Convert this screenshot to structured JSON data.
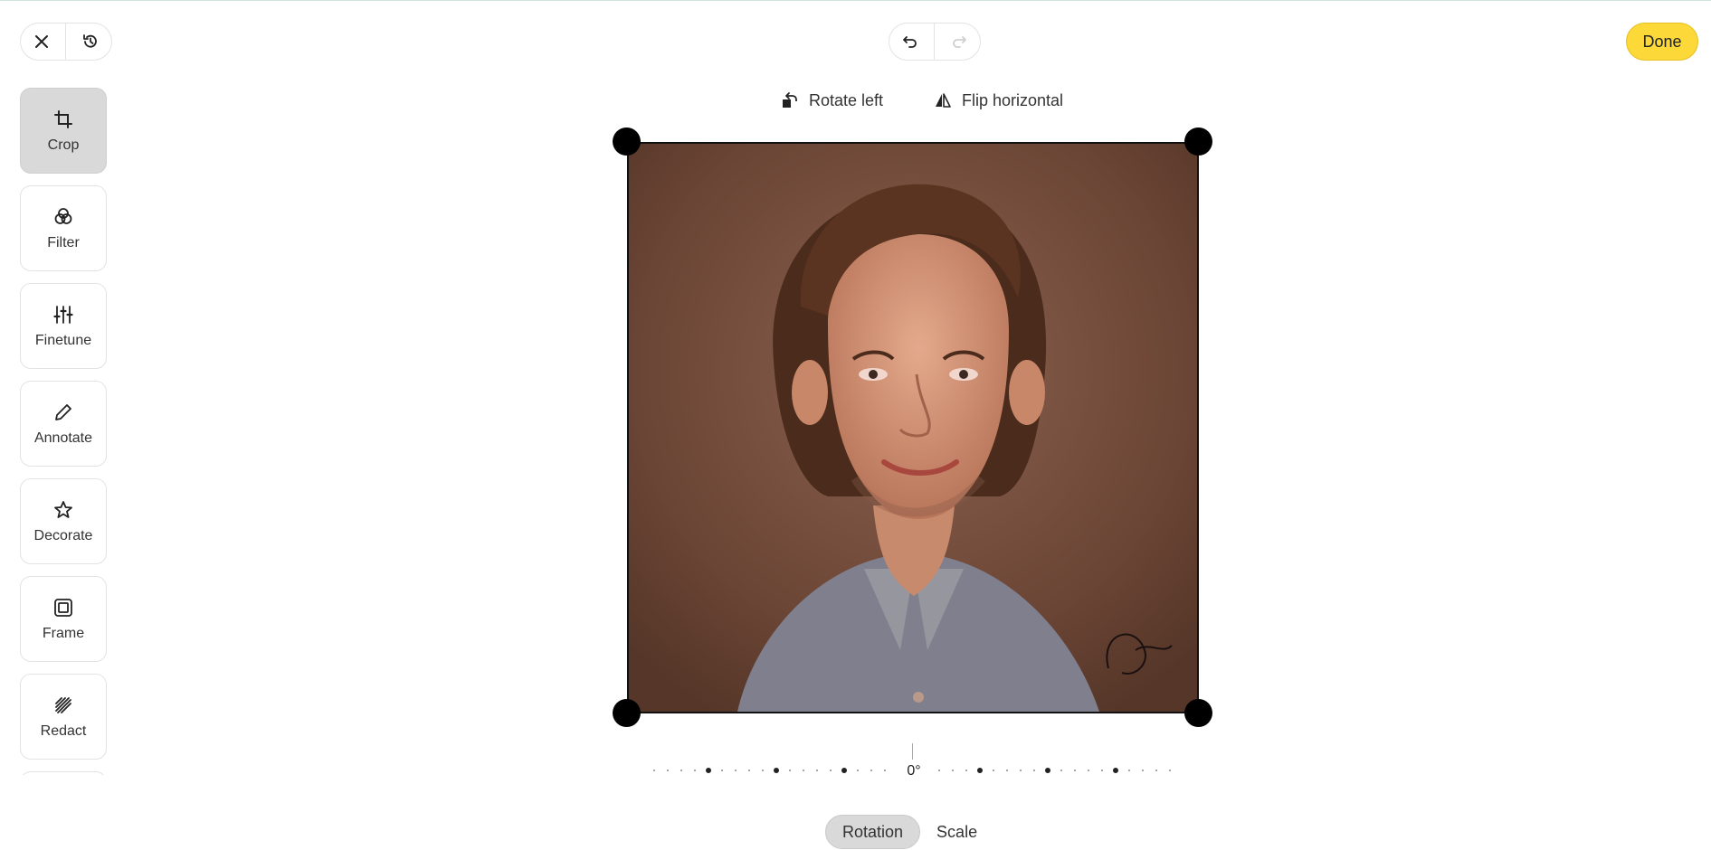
{
  "toolbar": {
    "close_icon": "close-icon",
    "history_icon": "history-icon",
    "undo_icon": "undo-icon",
    "redo_icon": "redo-icon",
    "done_label": "Done"
  },
  "sidebar": {
    "items": [
      {
        "label": "Crop",
        "icon": "crop-icon",
        "active": true
      },
      {
        "label": "Filter",
        "icon": "filter-icon",
        "active": false
      },
      {
        "label": "Finetune",
        "icon": "sliders-icon",
        "active": false
      },
      {
        "label": "Annotate",
        "icon": "pencil-icon",
        "active": false
      },
      {
        "label": "Decorate",
        "icon": "star-icon",
        "active": false
      },
      {
        "label": "Frame",
        "icon": "frame-icon",
        "active": false
      },
      {
        "label": "Redact",
        "icon": "redact-icon",
        "active": false
      }
    ]
  },
  "actions": {
    "rotate_left": "Rotate left",
    "flip_horizontal": "Flip horizontal"
  },
  "rotation": {
    "value_label": "0°"
  },
  "tabs": [
    {
      "label": "Rotation",
      "active": true
    },
    {
      "label": "Scale",
      "active": false
    }
  ],
  "colors": {
    "done_button": "#fcd839",
    "active_tool": "#d9d9d9"
  }
}
